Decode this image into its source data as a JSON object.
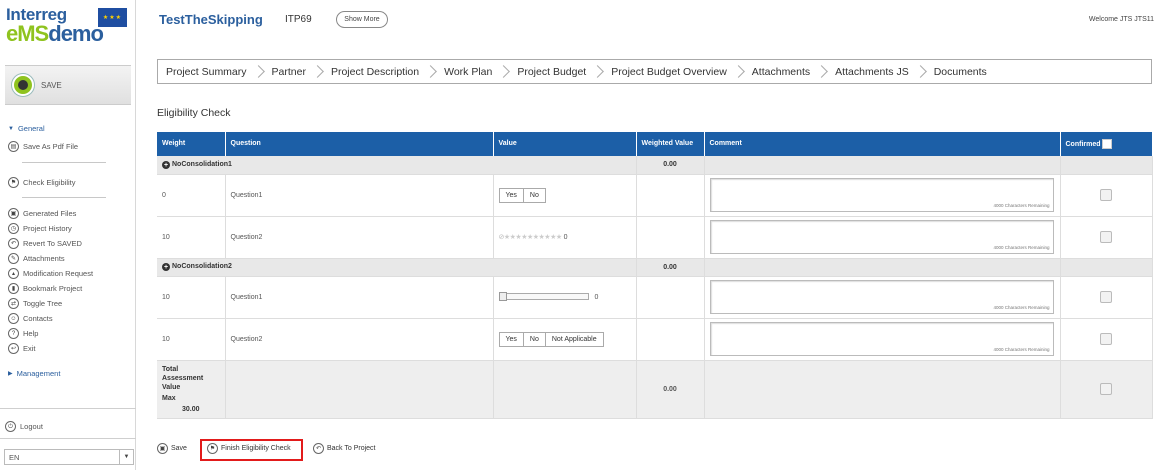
{
  "logo": {
    "line1": "Interreg",
    "line2_a": "eMS",
    "line2_b": "demo"
  },
  "sidebar": {
    "save_label": "SAVE",
    "general_label": "General",
    "items_a": [
      {
        "label": "Save As Pdf File",
        "icon": "pdf-icon"
      }
    ],
    "check_label": "Check Eligibility",
    "items_b": [
      {
        "label": "Generated Files",
        "icon": "files-icon"
      },
      {
        "label": "Project History",
        "icon": "history-icon"
      },
      {
        "label": "Revert To SAVED",
        "icon": "revert-icon"
      },
      {
        "label": "Attachments",
        "icon": "attachment-icon"
      },
      {
        "label": "Modification Request",
        "icon": "modification-icon"
      },
      {
        "label": "Bookmark Project",
        "icon": "bookmark-icon"
      },
      {
        "label": "Toggle Tree",
        "icon": "tree-icon"
      },
      {
        "label": "Contacts",
        "icon": "contacts-icon"
      },
      {
        "label": "Help",
        "icon": "help-icon"
      },
      {
        "label": "Exit",
        "icon": "exit-icon"
      }
    ],
    "management_label": "Management",
    "logout_label": "Logout",
    "language": "EN"
  },
  "header": {
    "title": "TestTheSkipping",
    "code": "ITP69",
    "show_more": "Show More",
    "welcome": "Welcome JTS JTS11"
  },
  "tabs": [
    "Project Summary",
    "Partner",
    "Project Description",
    "Work Plan",
    "Project Budget",
    "Project Budget Overview",
    "Attachments",
    "Attachments JS",
    "Documents"
  ],
  "section_title": "Eligibility Check",
  "table": {
    "headers": {
      "weight": "Weight",
      "question": "Question",
      "value": "Value",
      "weighted_value": "Weighted Value",
      "comment": "Comment",
      "confirmed": "Confirmed"
    },
    "remaining": "4000 Characters Remaining",
    "groups": [
      {
        "name": "NoConsolidation1",
        "weighted_value": "0.00",
        "rows": [
          {
            "weight": "0",
            "question": "Question1",
            "opts": [
              "Yes",
              "No"
            ]
          },
          {
            "weight": "10",
            "question": "Question2",
            "rating_value": "0"
          }
        ]
      },
      {
        "name": "NoConsolidation2",
        "weighted_value": "0.00",
        "rows": [
          {
            "weight": "10",
            "question": "Question1",
            "slider_value": "0"
          },
          {
            "weight": "10",
            "question": "Question2",
            "opts": [
              "Yes",
              "No",
              "Not Applicable"
            ]
          }
        ]
      }
    ],
    "total": {
      "label": "Total Assessment Value",
      "max_label": "Max",
      "max_value": "30.00",
      "weighted_value": "0.00"
    }
  },
  "footer": {
    "save": "Save",
    "finish": "Finish Eligibility Check",
    "back": "Back To Project"
  },
  "colors": {
    "header_blue": "#1c5fa7",
    "brand_green": "#8fc31f",
    "highlight_red": "#e21b1b"
  }
}
